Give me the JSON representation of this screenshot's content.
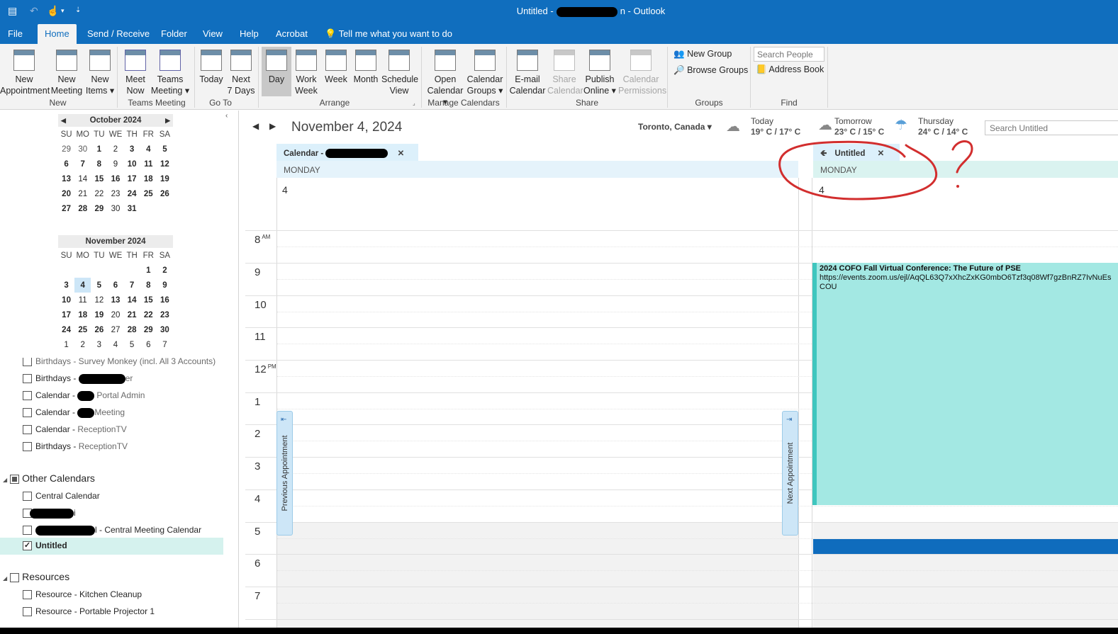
{
  "window": {
    "title_left": "Untitled -",
    "title_right": "n  -  Outlook"
  },
  "menu": {
    "file": "File",
    "home": "Home",
    "send_receive": "Send / Receive",
    "folder": "Folder",
    "view": "View",
    "help": "Help",
    "acrobat": "Acrobat",
    "tell_me": "Tell me what you want to do"
  },
  "ribbon": {
    "new_appointment": [
      "New",
      "Appointment"
    ],
    "new_meeting": [
      "New",
      "Meeting"
    ],
    "new_items": [
      "New",
      "Items ▾"
    ],
    "meet_now": [
      "Meet",
      "Now"
    ],
    "teams_meeting": [
      "Teams",
      "Meeting ▾"
    ],
    "today": "Today",
    "next7": [
      "Next",
      "7 Days"
    ],
    "day": "Day",
    "work_week": [
      "Work",
      "Week"
    ],
    "week": "Week",
    "month": "Month",
    "schedule_view": [
      "Schedule",
      "View"
    ],
    "open_calendar": [
      "Open",
      "Calendar ▾"
    ],
    "calendar_groups": [
      "Calendar",
      "Groups ▾"
    ],
    "email_calendar": [
      "E-mail",
      "Calendar"
    ],
    "share_calendar": [
      "Share",
      "Calendar"
    ],
    "publish_online": [
      "Publish",
      "Online ▾"
    ],
    "calendar_permissions": [
      "Calendar",
      "Permissions"
    ],
    "new_group": "New Group",
    "browse_groups": "Browse Groups",
    "search_people_placeholder": "Search People",
    "address_book": "Address Book",
    "groups": {
      "new": "New",
      "teams_meeting": "Teams Meeting",
      "go_to": "Go To",
      "arrange": "Arrange",
      "manage_calendars": "Manage Calendars",
      "share": "Share",
      "groups": "Groups",
      "find": "Find"
    }
  },
  "mini_calendars": [
    {
      "title": "October 2024",
      "weeks": [
        [
          "29",
          "30",
          "1",
          "2",
          "3",
          "4",
          "5"
        ],
        [
          "6",
          "7",
          "8",
          "9",
          "10",
          "11",
          "12"
        ],
        [
          "13",
          "14",
          "15",
          "16",
          "17",
          "18",
          "19"
        ],
        [
          "20",
          "21",
          "22",
          "23",
          "24",
          "25",
          "26"
        ],
        [
          "27",
          "28",
          "29",
          "30",
          "31",
          "",
          ""
        ]
      ]
    },
    {
      "title": "November 2024",
      "weeks": [
        [
          "",
          "",
          "",
          "",
          "",
          "1",
          "2"
        ],
        [
          "3",
          "4",
          "5",
          "6",
          "7",
          "8",
          "9"
        ],
        [
          "10",
          "11",
          "12",
          "13",
          "14",
          "15",
          "16"
        ],
        [
          "17",
          "18",
          "19",
          "20",
          "21",
          "22",
          "23"
        ],
        [
          "24",
          "25",
          "26",
          "27",
          "28",
          "29",
          "30"
        ],
        [
          "1",
          "2",
          "3",
          "4",
          "5",
          "6",
          "7"
        ]
      ]
    }
  ],
  "weekday_headers": [
    "SU",
    "MO",
    "TU",
    "WE",
    "TH",
    "FR",
    "SA"
  ],
  "calendar_list": {
    "partial_top": "Birthdays - Survey Monkey (incl. All 3 Accounts)",
    "items": [
      {
        "a": "Birthdays - ",
        "b": "er"
      },
      {
        "a": "Calendar - ",
        "b": "Portal Admin"
      },
      {
        "a": "Calendar - ",
        "b": "Meeting"
      },
      {
        "a": "Calendar - ",
        "b": "ReceptionTV"
      },
      {
        "a": "Birthdays - ",
        "b": "ReceptionTV"
      }
    ],
    "other_calendars": "Other Calendars",
    "central_calendar": "Central Calendar",
    "redacted_suffix": "i",
    "central_meeting": "l - Central Meeting Calendar",
    "untitled": "Untitled",
    "resources": "Resources",
    "kitchen": "Resource - Kitchen Cleanup",
    "projector": "Resource - Portable Projector 1"
  },
  "day_view": {
    "date_title": "November 4, 2024",
    "location": "Toronto, Canada ▾",
    "weather": [
      {
        "label": "Today",
        "temp": "19° C / 17° C"
      },
      {
        "label": "Tomorrow",
        "temp": "23° C / 15° C"
      },
      {
        "label": "Thursday",
        "temp": "24° C / 14° C"
      }
    ],
    "search_placeholder": "Search Untitled",
    "tab1_label": "Calendar -",
    "tab2_label": "Untitled",
    "weekday": "MONDAY",
    "day_number": "4",
    "hours": [
      {
        "h": "8",
        "s": "AM"
      },
      {
        "h": "9",
        "s": ""
      },
      {
        "h": "10",
        "s": ""
      },
      {
        "h": "11",
        "s": ""
      },
      {
        "h": "12",
        "s": "PM"
      },
      {
        "h": "1",
        "s": ""
      },
      {
        "h": "2",
        "s": ""
      },
      {
        "h": "3",
        "s": ""
      },
      {
        "h": "4",
        "s": ""
      },
      {
        "h": "5",
        "s": ""
      },
      {
        "h": "6",
        "s": ""
      },
      {
        "h": "7",
        "s": ""
      }
    ],
    "previous_appointment": "Previous Appointment",
    "next_appointment": "Next Appointment",
    "appointment": {
      "title": "2024 COFO Fall Virtual Conference: The Future of PSE",
      "line2": "https://events.zoom.us/ejl/AqQL63Q7xXhcZxKG0mbO6Tzf3q08Wf7gzBnRZ7IvNuEs",
      "line3": "COU"
    }
  }
}
